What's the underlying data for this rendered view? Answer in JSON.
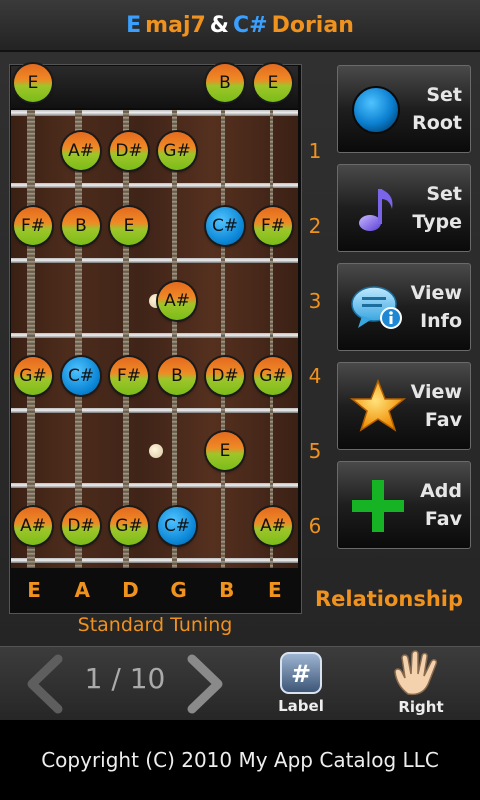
{
  "header": {
    "root_note": "E",
    "chord_quality": "maj7",
    "ampersand": "&",
    "scale_root": "C#",
    "scale_mode": "Dorian",
    "colors": {
      "blue_accent": "#3aa0ff",
      "orange_accent": "#f0921e"
    }
  },
  "fretboard": {
    "open_notes": [
      "E",
      "",
      "",
      "",
      "B",
      "E"
    ],
    "fret_numbers": [
      "1",
      "2",
      "3",
      "4",
      "5",
      "6"
    ],
    "frets": [
      [
        "",
        "A#",
        "D#",
        "G#",
        "",
        ""
      ],
      [
        "F#",
        "B",
        "E",
        "",
        "C#",
        "F#"
      ],
      [
        "",
        "",
        "",
        "A#",
        "",
        ""
      ],
      [
        "G#",
        "C#",
        "F#",
        "B",
        "D#",
        "G#"
      ],
      [
        "",
        "",
        "",
        "",
        "E",
        ""
      ],
      [
        "A#",
        "D#",
        "G#",
        "C#",
        "",
        "A#"
      ]
    ],
    "tuning": [
      "E",
      "A",
      "D",
      "G",
      "B",
      "E"
    ],
    "tuning_label": "Standard Tuning",
    "relationship_label": "Relationship"
  },
  "actions": {
    "set_root": {
      "line1": "Set",
      "line2": "Root",
      "icon": "blue-circle-icon"
    },
    "set_type": {
      "line1": "Set",
      "line2": "Type",
      "icon": "music-note-icon"
    },
    "view_info": {
      "line1": "View",
      "line2": "Info",
      "icon": "info-bubble-icon"
    },
    "view_fav": {
      "line1": "View",
      "line2": "Fav",
      "icon": "star-icon"
    },
    "add_fav": {
      "line1": "Add",
      "line2": "Fav",
      "icon": "plus-icon"
    }
  },
  "nav": {
    "page_indicator": "1 / 10",
    "label_button": "Label",
    "label_icon_text": "#",
    "right_button": "Right"
  },
  "footer": {
    "copyright": "Copyright (C) 2010 My App Catalog LLC"
  }
}
